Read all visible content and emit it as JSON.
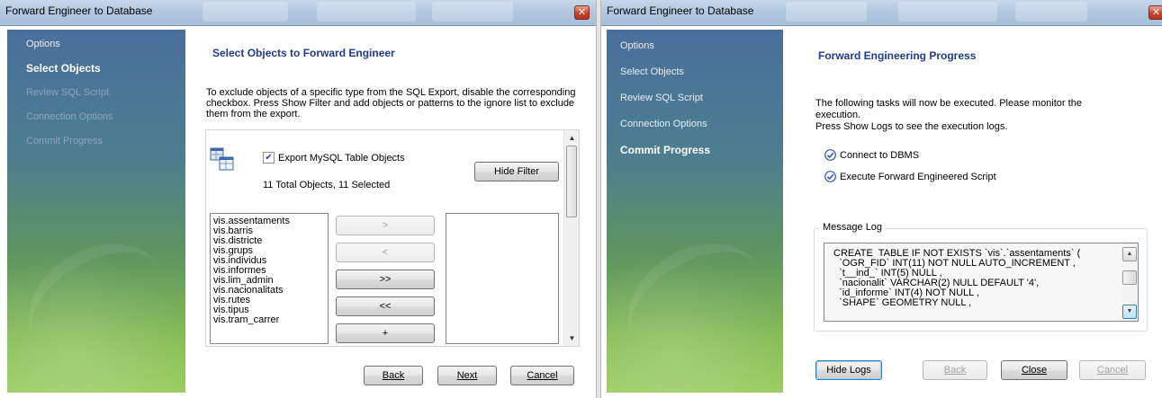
{
  "left": {
    "window_title": "Forward Engineer to Database",
    "sidebar": {
      "items": [
        {
          "label": "Options",
          "state": "normal"
        },
        {
          "label": "Select Objects",
          "state": "active"
        },
        {
          "label": "Review SQL Script",
          "state": "disabled"
        },
        {
          "label": "Connection Options",
          "state": "disabled"
        },
        {
          "label": "Commit Progress",
          "state": "disabled"
        }
      ]
    },
    "heading": "Select Objects to Forward Engineer",
    "description": "To exclude objects of a specific type from the SQL Export, disable the corresponding checkbox. Press Show Filter and add objects or patterns to the ignore list to exclude them from the export.",
    "export_checkbox": {
      "label": "Export MySQL Table Objects",
      "checked": true
    },
    "objects_summary": "11 Total Objects, 11 Selected",
    "hide_filter_label": "Hide Filter",
    "objects_list": [
      "vis.assentaments",
      "vis.barris",
      "vis.districte",
      "vis.grups",
      "vis.individus",
      "vis.informes",
      "vis.lim_admin",
      "vis.nacionalitats",
      "vis.rutes",
      "vis.tipus",
      "vis.tram_carrer"
    ],
    "move_buttons": [
      {
        "label": ">",
        "enabled": false
      },
      {
        "label": "<",
        "enabled": false
      },
      {
        "label": ">>",
        "enabled": true
      },
      {
        "label": "<<",
        "enabled": true
      },
      {
        "label": "+",
        "enabled": true
      }
    ],
    "back_label": "Back",
    "next_label": "Next",
    "cancel_label": "Cancel"
  },
  "right": {
    "window_title": "Forward Engineer to Database",
    "sidebar": {
      "items": [
        {
          "label": "Options",
          "state": "normal"
        },
        {
          "label": "Select Objects",
          "state": "normal"
        },
        {
          "label": "Review SQL Script",
          "state": "normal"
        },
        {
          "label": "Connection Options",
          "state": "normal"
        },
        {
          "label": "Commit Progress",
          "state": "active"
        }
      ]
    },
    "heading": "Forward Engineering Progress",
    "description_line1": "The following tasks will now be executed. Please monitor the",
    "description_line2": "execution.",
    "description_line3": "Press Show Logs to see the execution logs.",
    "tasks": [
      "Connect to DBMS",
      "Execute Forward Engineered Script"
    ],
    "message_log_label": "Message Log",
    "log_lines": [
      "CREATE  TABLE IF NOT EXISTS `vis`.`assentaments` (",
      "  `OGR_FID` INT(11) NOT NULL AUTO_INCREMENT ,",
      "  `t__ind_` INT(5) NULL ,",
      "  `nacionalit` VARCHAR(2) NULL DEFAULT '4',",
      "  `id_informe` INT(4) NOT NULL ,",
      "  `SHAPE` GEOMETRY NULL ,"
    ],
    "hide_logs_label": "Hide Logs",
    "back_label": "Back",
    "close_label": "Close",
    "cancel_label": "Cancel"
  },
  "colors": {
    "heading": "#1f3d87",
    "check_accent": "#2d5aa6"
  }
}
